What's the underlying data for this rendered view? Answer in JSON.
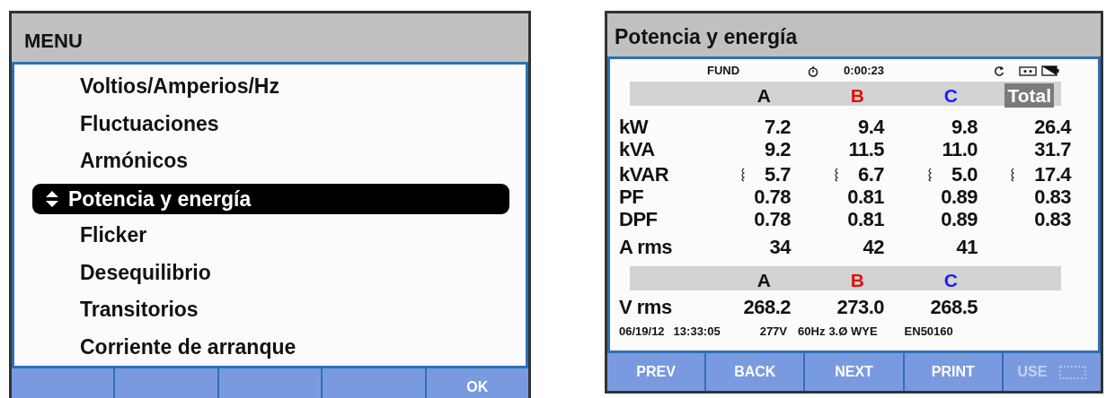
{
  "menu_screen": {
    "title": "MENU",
    "items": [
      {
        "label": "Voltios/Amperios/Hz",
        "selected": false
      },
      {
        "label": "Fluctuaciones",
        "selected": false
      },
      {
        "label": "Armónicos",
        "selected": false
      },
      {
        "label": "Potencia y energía",
        "selected": true
      },
      {
        "label": "Flicker",
        "selected": false
      },
      {
        "label": "Desequilibrio",
        "selected": false
      },
      {
        "label": "Transitorios",
        "selected": false
      },
      {
        "label": "Corriente de arranque",
        "selected": false
      }
    ],
    "softkeys": [
      "OK"
    ]
  },
  "power_screen": {
    "title": "Potencia y energía",
    "status": {
      "mode": "FUND",
      "timer": "0:00:23"
    },
    "header": [
      {
        "label": "A",
        "color": "#111111"
      },
      {
        "label": "B",
        "color": "#e01010"
      },
      {
        "label": "C",
        "color": "#1a1aff"
      },
      {
        "label": "Total",
        "color": "#ffffff"
      }
    ],
    "rows": [
      {
        "label": "kW",
        "values": [
          "7.2",
          "9.4",
          "9.8",
          "26.4"
        ],
        "kind": "plain"
      },
      {
        "label": "kVA",
        "values": [
          "9.2",
          "11.5",
          "11.0",
          "31.7"
        ],
        "kind": "plain"
      },
      {
        "label": "kVAR",
        "values": [
          "5.7",
          "6.7",
          "5.0",
          "17.4"
        ],
        "kind": "reactive"
      },
      {
        "label": "PF",
        "values": [
          "0.78",
          "0.81",
          "0.89",
          "0.83"
        ],
        "kind": "plain"
      },
      {
        "label": "DPF",
        "values": [
          "0.78",
          "0.81",
          "0.89",
          "0.83"
        ],
        "kind": "plain"
      },
      {
        "label": "A rms",
        "values": [
          "34",
          "42",
          "41"
        ],
        "kind": "plain"
      }
    ],
    "voltage_header": [
      {
        "label": "A",
        "color": "#111111"
      },
      {
        "label": "B",
        "color": "#e01010"
      },
      {
        "label": "C",
        "color": "#1a1aff"
      }
    ],
    "voltage_rows": [
      {
        "label": "V rms",
        "values": [
          "268.2",
          "273.0",
          "268.5"
        ]
      }
    ],
    "footer": [
      "06/19/12",
      "13:33:05",
      "277V",
      "60Hz",
      "3.Ø WYE",
      "EN50160"
    ],
    "softkeys": [
      {
        "label": "PREV",
        "disabled": false
      },
      {
        "label": "BACK",
        "disabled": false
      },
      {
        "label": "NEXT",
        "disabled": false
      },
      {
        "label": "PRINT",
        "disabled": false
      },
      {
        "label": "USE",
        "disabled": true
      }
    ]
  }
}
